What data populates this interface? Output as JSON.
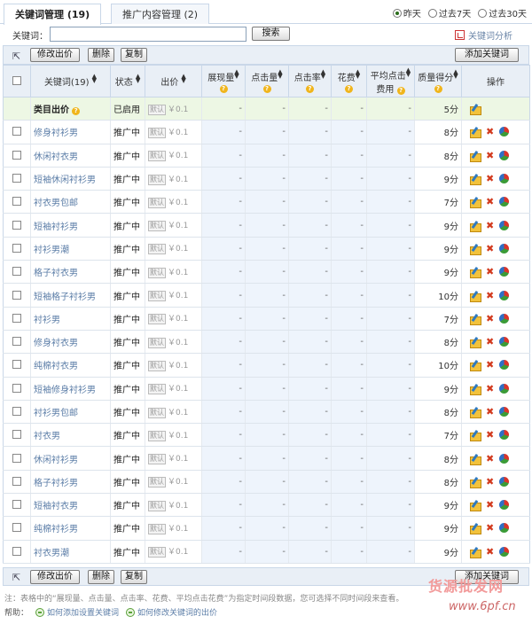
{
  "tabs": [
    {
      "label": "关键词管理 (19)",
      "active": true
    },
    {
      "label": "推广内容管理 (2)",
      "active": false
    }
  ],
  "time_range": [
    {
      "label": "昨天",
      "selected": true
    },
    {
      "label": "过去7天",
      "selected": false
    },
    {
      "label": "过去30天",
      "selected": false
    }
  ],
  "search": {
    "label": "关键词：",
    "value": "",
    "button": "搜索"
  },
  "keyword_analysis": "关键词分析",
  "toolbar": {
    "edit_bid": "修改出价",
    "delete": "删除",
    "copy": "复制",
    "add_keyword": "添加关键词"
  },
  "columns": {
    "keyword": "关键词(19)",
    "status": "状态",
    "bid": "出价",
    "impressions": "展现量",
    "clicks": "点击量",
    "ctr": "点击率",
    "cost": "花费",
    "avg_cpc_1": "平均点击",
    "avg_cpc_2": "费用",
    "quality": "质量得分",
    "actions": "操作"
  },
  "category_row": {
    "name": "类目出价",
    "status": "已启用",
    "default_tag": "默认",
    "bid": "￥0.1",
    "impressions": "-",
    "clicks": "-",
    "ctr": "-",
    "cost": "-",
    "avg_cpc": "-",
    "quality": "5分"
  },
  "rows": [
    {
      "keyword": "修身衬衫男",
      "status": "推广中",
      "default_tag": "默认",
      "bid": "￥0.1",
      "impressions": "-",
      "clicks": "-",
      "ctr": "-",
      "cost": "-",
      "avg_cpc": "-",
      "quality": "8分"
    },
    {
      "keyword": "休闲衬衣男",
      "status": "推广中",
      "default_tag": "默认",
      "bid": "￥0.1",
      "impressions": "-",
      "clicks": "-",
      "ctr": "-",
      "cost": "-",
      "avg_cpc": "-",
      "quality": "8分"
    },
    {
      "keyword": "短袖休闲衬衫男",
      "status": "推广中",
      "default_tag": "默认",
      "bid": "￥0.1",
      "impressions": "-",
      "clicks": "-",
      "ctr": "-",
      "cost": "-",
      "avg_cpc": "-",
      "quality": "9分"
    },
    {
      "keyword": "衬衣男包邮",
      "status": "推广中",
      "default_tag": "默认",
      "bid": "￥0.1",
      "impressions": "-",
      "clicks": "-",
      "ctr": "-",
      "cost": "-",
      "avg_cpc": "-",
      "quality": "7分"
    },
    {
      "keyword": "短袖衬衫男",
      "status": "推广中",
      "default_tag": "默认",
      "bid": "￥0.1",
      "impressions": "-",
      "clicks": "-",
      "ctr": "-",
      "cost": "-",
      "avg_cpc": "-",
      "quality": "9分"
    },
    {
      "keyword": "衬衫男潮",
      "status": "推广中",
      "default_tag": "默认",
      "bid": "￥0.1",
      "impressions": "-",
      "clicks": "-",
      "ctr": "-",
      "cost": "-",
      "avg_cpc": "-",
      "quality": "9分"
    },
    {
      "keyword": "格子衬衣男",
      "status": "推广中",
      "default_tag": "默认",
      "bid": "￥0.1",
      "impressions": "-",
      "clicks": "-",
      "ctr": "-",
      "cost": "-",
      "avg_cpc": "-",
      "quality": "9分"
    },
    {
      "keyword": "短袖格子衬衫男",
      "status": "推广中",
      "default_tag": "默认",
      "bid": "￥0.1",
      "impressions": "-",
      "clicks": "-",
      "ctr": "-",
      "cost": "-",
      "avg_cpc": "-",
      "quality": "10分"
    },
    {
      "keyword": "衬衫男",
      "status": "推广中",
      "default_tag": "默认",
      "bid": "￥0.1",
      "impressions": "-",
      "clicks": "-",
      "ctr": "-",
      "cost": "-",
      "avg_cpc": "-",
      "quality": "7分"
    },
    {
      "keyword": "修身衬衣男",
      "status": "推广中",
      "default_tag": "默认",
      "bid": "￥0.1",
      "impressions": "-",
      "clicks": "-",
      "ctr": "-",
      "cost": "-",
      "avg_cpc": "-",
      "quality": "8分"
    },
    {
      "keyword": "纯棉衬衣男",
      "status": "推广中",
      "default_tag": "默认",
      "bid": "￥0.1",
      "impressions": "-",
      "clicks": "-",
      "ctr": "-",
      "cost": "-",
      "avg_cpc": "-",
      "quality": "10分"
    },
    {
      "keyword": "短袖修身衬衫男",
      "status": "推广中",
      "default_tag": "默认",
      "bid": "￥0.1",
      "impressions": "-",
      "clicks": "-",
      "ctr": "-",
      "cost": "-",
      "avg_cpc": "-",
      "quality": "9分"
    },
    {
      "keyword": "衬衫男包邮",
      "status": "推广中",
      "default_tag": "默认",
      "bid": "￥0.1",
      "impressions": "-",
      "clicks": "-",
      "ctr": "-",
      "cost": "-",
      "avg_cpc": "-",
      "quality": "8分"
    },
    {
      "keyword": "衬衣男",
      "status": "推广中",
      "default_tag": "默认",
      "bid": "￥0.1",
      "impressions": "-",
      "clicks": "-",
      "ctr": "-",
      "cost": "-",
      "avg_cpc": "-",
      "quality": "7分"
    },
    {
      "keyword": "休闲衬衫男",
      "status": "推广中",
      "default_tag": "默认",
      "bid": "￥0.1",
      "impressions": "-",
      "clicks": "-",
      "ctr": "-",
      "cost": "-",
      "avg_cpc": "-",
      "quality": "8分"
    },
    {
      "keyword": "格子衬衫男",
      "status": "推广中",
      "default_tag": "默认",
      "bid": "￥0.1",
      "impressions": "-",
      "clicks": "-",
      "ctr": "-",
      "cost": "-",
      "avg_cpc": "-",
      "quality": "8分"
    },
    {
      "keyword": "短袖衬衣男",
      "status": "推广中",
      "default_tag": "默认",
      "bid": "￥0.1",
      "impressions": "-",
      "clicks": "-",
      "ctr": "-",
      "cost": "-",
      "avg_cpc": "-",
      "quality": "9分"
    },
    {
      "keyword": "纯棉衬衫男",
      "status": "推广中",
      "default_tag": "默认",
      "bid": "￥0.1",
      "impressions": "-",
      "clicks": "-",
      "ctr": "-",
      "cost": "-",
      "avg_cpc": "-",
      "quality": "9分"
    },
    {
      "keyword": "衬衣男潮",
      "status": "推广中",
      "default_tag": "默认",
      "bid": "￥0.1",
      "impressions": "-",
      "clicks": "-",
      "ctr": "-",
      "cost": "-",
      "avg_cpc": "-",
      "quality": "9分"
    }
  ],
  "note": "注：表格中的“展现量、点击量、点击率、花费、平均点击花费”为指定时间段数据，您可选择不同时间段来查看。",
  "help": {
    "label": "帮助：",
    "links": [
      "如何添加设置关键词",
      "如何修改关键词的出价"
    ]
  },
  "watermark": {
    "line1": "货源批发网",
    "line2": "www.6pf.cn"
  }
}
